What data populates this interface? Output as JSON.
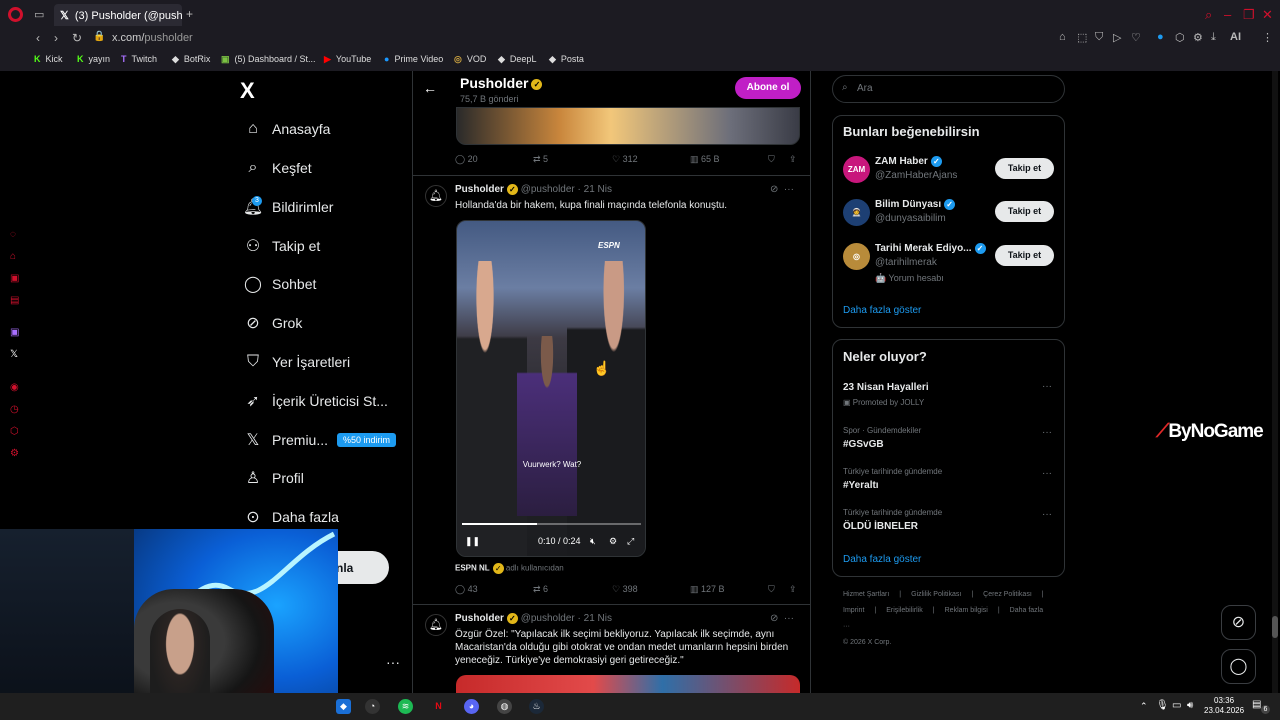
{
  "browser": {
    "tab_title": "(3) Pusholder (@pusholder",
    "url_host": "x.com/",
    "url_path": "pusholder",
    "toolbar_ai": "AI",
    "bookmarks": [
      {
        "label": "Kick",
        "icon": "K"
      },
      {
        "label": "yayın",
        "icon": "K"
      },
      {
        "label": "Twitch",
        "icon": "T"
      },
      {
        "label": "BotRix",
        "icon": "◆"
      },
      {
        "label": "(5) Dashboard / St...",
        "icon": "▣"
      },
      {
        "label": "YouTube",
        "icon": "▶"
      },
      {
        "label": "Prime Video",
        "icon": "●"
      },
      {
        "label": "VOD",
        "icon": "◎"
      },
      {
        "label": "DeepL",
        "icon": "◆"
      },
      {
        "label": "Posta",
        "icon": "◆"
      }
    ]
  },
  "nav": {
    "logo": "X",
    "items": [
      {
        "label": "Anasayfa",
        "icon": "home-icon"
      },
      {
        "label": "Keşfet",
        "icon": "search-icon"
      },
      {
        "label": "Bildirimler",
        "icon": "bell-icon"
      },
      {
        "label": "Takip et",
        "icon": "add-user-icon"
      },
      {
        "label": "Sohbet",
        "icon": "chat-icon"
      },
      {
        "label": "Grok",
        "icon": "grok-icon"
      },
      {
        "label": "Yer İşaretleri",
        "icon": "bookmark-icon"
      },
      {
        "label": "İçerik Üreticisi St...",
        "icon": "rocket-icon"
      },
      {
        "label": "Premiu...",
        "icon": "x-icon"
      },
      {
        "label": "Profil",
        "icon": "person-icon"
      },
      {
        "label": "Daha fazla",
        "icon": "more-icon"
      }
    ],
    "notification_count": "3",
    "premium_badge": "%50 indirim",
    "post_button_partial": "nla"
  },
  "profile_header": {
    "name": "Pusholder",
    "posts": "75,7 B gönderi",
    "subscribe": "Abone ol"
  },
  "posts": [
    {
      "stats": {
        "replies": "20",
        "reposts": "5",
        "likes": "312",
        "views": "65 B"
      }
    },
    {
      "name": "Pusholder",
      "handle": "@pusholder",
      "date": "· 21 Nis",
      "text": "Hollanda'da bir hakem, kupa finali maçında telefonla konuştu.",
      "video": {
        "watermark": "ESPN",
        "caption": "Vuurwerk? Wat?",
        "time": "0:10 / 0:24",
        "progress": 0.42
      },
      "source_label": "ESPN NL",
      "source_note": "adlı kullanıcıdan",
      "stats": {
        "replies": "43",
        "reposts": "6",
        "likes": "398",
        "views": "127 B"
      }
    },
    {
      "name": "Pusholder",
      "handle": "@pusholder",
      "date": "· 21 Nis",
      "text": "Özgür Özel: \"Yapılacak ilk seçimi bekliyoruz. Yapılacak ilk seçimde, aynı Macaristan'da olduğu gibi otokrat ve ondan medet umanların hepsini birden yeneceğiz. Türkiye'ye demokrasiyi geri getireceğiz.\""
    }
  ],
  "right": {
    "search_placeholder": "Ara",
    "suggest_title": "Bunları beğenebilirsin",
    "suggestions": [
      {
        "name": "ZAM Haber",
        "handle": "@ZamHaberAjans",
        "avatar": "ZAM",
        "color": "#c8177c",
        "extra": ""
      },
      {
        "name": "Bilim Dünyası",
        "handle": "@dunyasaibilim",
        "avatar": "",
        "color": "#1d3f73",
        "extra": ""
      },
      {
        "name": "Tarihi Merak Ediyo...",
        "handle": "@tarihilmerak",
        "avatar": "",
        "color": "#b88b3a",
        "extra": "🤖 Yorum hesabı"
      }
    ],
    "follow_label": "Takip et",
    "show_more": "Daha fazla göster",
    "trends_title": "Neler oluyor?",
    "trends": [
      {
        "category": "",
        "name": "23 Nisan Hayalleri",
        "promo": "Promoted by JOLLY"
      },
      {
        "category": "Spor · Gündemdekiler",
        "name": "#GSvGB",
        "promo": ""
      },
      {
        "category": "Türkiye tarihinde gündemde",
        "name": "#Yeraltı",
        "promo": ""
      },
      {
        "category": "Türkiye tarihinde gündemde",
        "name": "ÖLDÜ İBNELER",
        "promo": ""
      }
    ],
    "trends_more": "Daha fazla göster",
    "footer": [
      "Hizmet Şartları",
      "|",
      "Gizlilik Politikası",
      "|",
      "Çerez Politikası",
      "|",
      "Imprint",
      "|",
      "Erişilebilirlik",
      "|",
      "Reklam bilgisi",
      "|",
      "Daha fazla ···",
      "© 2026 X Corp."
    ]
  },
  "overlay": {
    "brand": "ByNoGame"
  },
  "taskbar": {
    "time": "03:36",
    "date": "23.04.2026",
    "notif": "6"
  }
}
